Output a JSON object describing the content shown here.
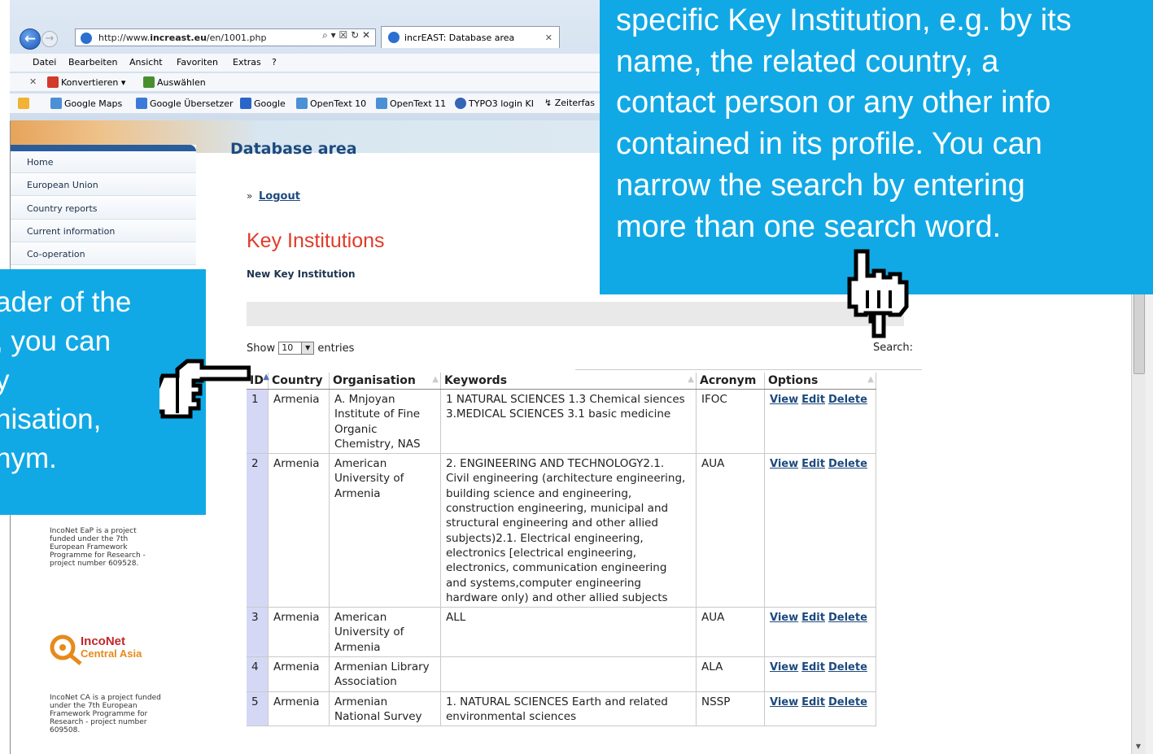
{
  "browser": {
    "url": "http://www.increast.eu/en/1001.php",
    "url_host": "http://www.",
    "url_bold": "increast.eu",
    "url_path": "/en/1001.php",
    "url_tools": "⌕ ▾ ☒ ↻ ✕",
    "tab_title": "incrEAST: Database area",
    "tab_close": "✕",
    "menu": [
      "Datei",
      "Bearbeiten",
      "Ansicht",
      "Favoriten",
      "Extras",
      "?"
    ],
    "toolbar_close": "✕",
    "toolbar_convert": "Konvertieren",
    "toolbar_select": "Auswählen",
    "favorites": [
      "Google Maps",
      "Google Übersetzer",
      "Google",
      "OpenText 10",
      "OpenText 11",
      "TYPO3 login KI",
      "Zeiterfas"
    ]
  },
  "sidebar": {
    "items": [
      "Home",
      "European Union",
      "Country reports",
      "Current information",
      "Co-operation"
    ],
    "note_eap": "IncoNet EaP is a project funded under the 7th European Framework Programme for Research - project number 609528.",
    "logo_text_1": "IncoNet",
    "logo_text_2": "Central Asia",
    "note_ca": "IncoNet CA is a project funded under the 7th European Framework Programme for Research - project number 609508."
  },
  "main": {
    "db_title": "Database area",
    "logout_arrow": "»",
    "logout": "Logout",
    "heading": "Key Institutions",
    "new_link": "New Key Institution",
    "show_label": "Show",
    "show_value": "10",
    "entries_label": "entries",
    "search_label": "Search:"
  },
  "table": {
    "columns": [
      "ID",
      "Country",
      "Organisation",
      "Keywords",
      "Acronym",
      "Options"
    ],
    "option_labels": [
      "View",
      "Edit",
      "Delete"
    ],
    "rows": [
      {
        "id": "1",
        "country": "Armenia",
        "organisation": "A. Mnjoyan Institute of Fine Organic Chemistry, NAS",
        "keywords": "1 NATURAL SCIENCES 1.3 Chemical siences 3.MEDICAL SCIENCES 3.1 basic medicine",
        "acronym": "IFOC"
      },
      {
        "id": "2",
        "country": "Armenia",
        "organisation": "American University of Armenia",
        "keywords": "2. ENGINEERING AND TECHNOLOGY2.1. Civil engineering (architecture engineering, building science and engineering, construction engineering, municipal and structural engineering and other allied subjects)2.1. Electrical engineering, electronics [electrical engineering, electronics, communication engineering and systems,computer engineering hardware only) and other allied subjects",
        "acronym": "AUA"
      },
      {
        "id": "3",
        "country": "Armenia",
        "organisation": "American University of Armenia",
        "keywords": "ALL",
        "acronym": "AUA"
      },
      {
        "id": "4",
        "country": "Armenia",
        "organisation": "Armenian Library Association",
        "keywords": "",
        "acronym": "ALA"
      },
      {
        "id": "5",
        "country": "Armenia",
        "organisation": "Armenian National Survey",
        "keywords": "1. NATURAL SCIENCES Earth and related environmental sciences",
        "acronym": "NSSP"
      }
    ]
  },
  "callouts": {
    "right_lines": [
      "specific Key Institution, e.g. by its",
      "name, the related country, a",
      "contact person or any other info",
      "contained in its profile. You can",
      "narrow the search by entering",
      "more than one search word."
    ],
    "left_lines": [
      "ader of the",
      ", you can",
      "y",
      "nisation,",
      "nym."
    ]
  },
  "colors": {
    "callout_bg": "#11a9e5",
    "heading_red": "#e03b2a",
    "link_blue": "#1d4a7e",
    "id_cell_bg": "#d5d8f5"
  }
}
